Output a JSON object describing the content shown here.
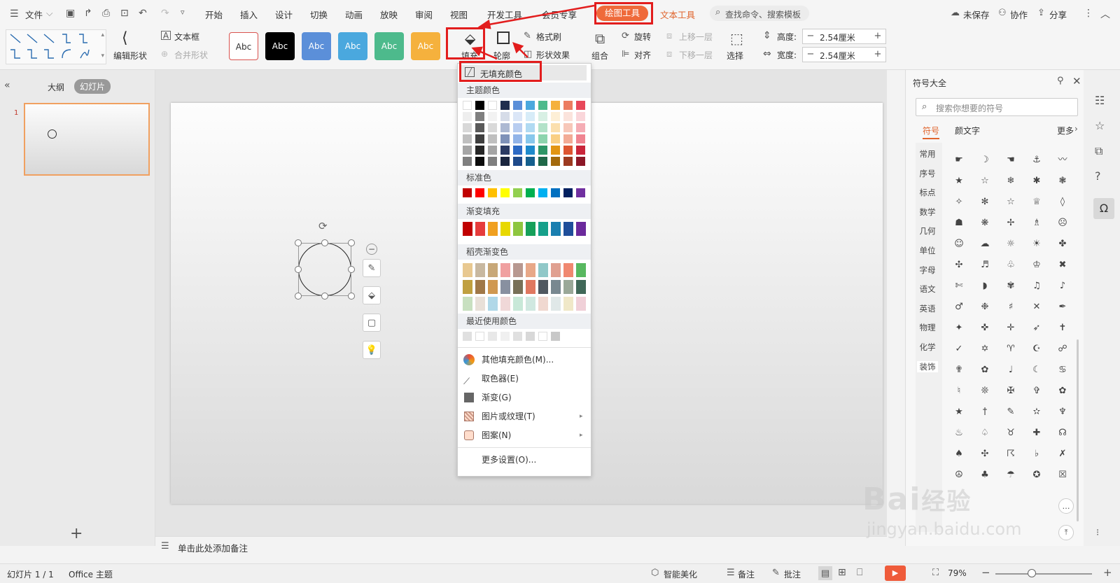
{
  "menu": {
    "file": "文件",
    "tabs": [
      "开始",
      "插入",
      "设计",
      "切换",
      "动画",
      "放映",
      "审阅",
      "视图",
      "开发工具",
      "会员专享"
    ],
    "drawing_tools": "绘图工具",
    "text_tools": "文本工具",
    "search": "查找命令、搜索模板",
    "unsaved": "未保存",
    "collab": "协作",
    "share": "分享"
  },
  "ribbon": {
    "edit_shape": "编辑形状",
    "textbox": "文本框",
    "merge_shape": "合并形状",
    "style_label": "Abc",
    "fill": "填充",
    "outline": "轮廓",
    "format_painter": "格式刷",
    "shape_effect": "形状效果",
    "group": "组合",
    "rotate": "旋转",
    "align": "对齐",
    "bring_forward": "上移一层",
    "send_backward": "下移一层",
    "select": "选择",
    "height_label": "高度:",
    "height_value": "2.54厘米",
    "width_label": "宽度:",
    "width_value": "2.54厘米"
  },
  "left_pane": {
    "outline_tab": "大纲",
    "slides_tab": "幻灯片",
    "slide_number": "1"
  },
  "notes_placeholder": "单击此处添加备注",
  "fill_menu": {
    "no_fill": "无填充颜色",
    "theme_colors": "主题颜色",
    "standard_colors": "标准色",
    "gradient_fill": "渐变填充",
    "daoke_gradient": "稻壳渐变色",
    "recent_colors": "最近使用颜色",
    "more_fill": "其他填充颜色(M)...",
    "eyedropper": "取色器(E)",
    "gradient": "渐变(G)",
    "picture_texture": "图片或纹理(T)",
    "pattern": "图案(N)",
    "more_settings": "更多设置(O)..."
  },
  "symbol_panel": {
    "title": "符号大全",
    "search_placeholder": "搜索你想要的符号",
    "tab_symbols": "符号",
    "tab_emoticons": "颜文字",
    "more": "更多",
    "categories": [
      "常用",
      "序号",
      "标点",
      "数学",
      "几何",
      "单位",
      "字母",
      "语文",
      "英语",
      "物理",
      "化学",
      "装饰"
    ],
    "symbols": [
      "☛",
      "☽",
      "☚",
      "⚓",
      "〰",
      "★",
      "☆",
      "❄",
      "✱",
      "❃",
      "✧",
      "✻",
      "☆",
      "♕",
      "◊",
      "☗",
      "❋",
      "✢",
      "♗",
      "☹",
      "☺",
      "☁",
      "☼",
      "☀",
      "✤",
      "✣",
      "♬",
      "♧",
      "♔",
      "✖",
      "✄",
      "◗",
      "✾",
      "♫",
      "♪",
      "♂",
      "❉",
      "♯",
      "✕",
      "✒",
      "✦",
      "✜",
      "✛",
      "➶",
      "✝",
      "✓",
      "✡",
      "♈",
      "☪",
      "☍",
      "✟",
      "✿",
      "♩",
      "☾",
      "♋",
      "♮",
      "❊",
      "✠",
      "✞",
      "✿",
      "★",
      "†",
      "✎",
      "✫",
      "♆",
      "♨",
      "♤",
      "♉",
      "✚",
      "☊",
      "♠",
      "✣",
      "☈",
      "♭",
      "✗",
      "☮",
      "♣",
      "☂",
      "✪",
      "☒"
    ]
  },
  "status": {
    "slide_info": "幻灯片 1 / 1",
    "theme": "Office 主题",
    "smart_beautify": "智能美化",
    "notes": "备注",
    "comments": "批注",
    "zoom": "79%"
  },
  "colors": {
    "accent_red": "#e21d1d",
    "drawing_tab_bg": "#ef6a3a",
    "selected_thumb_border": "#f0a060"
  }
}
